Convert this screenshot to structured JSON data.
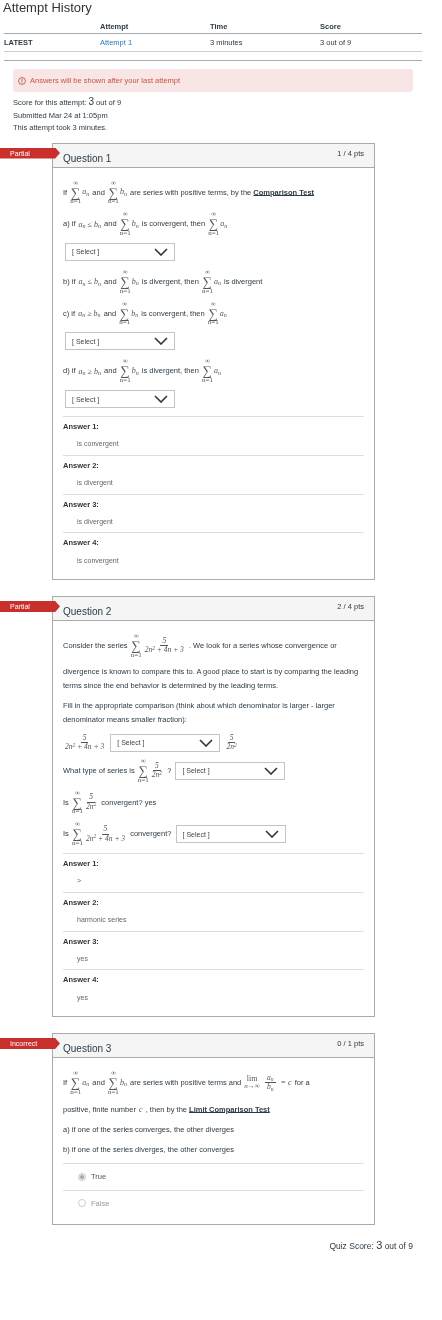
{
  "page_title": "Attempt History",
  "attempts_table": {
    "columns": [
      "Attempt",
      "Time",
      "Score"
    ],
    "rows": [
      {
        "label": "LATEST",
        "attempt": "Attempt 1",
        "time": "3 minutes",
        "score": "3 out of 9"
      }
    ]
  },
  "notice": "Answers will be shown after your last attempt",
  "score": {
    "label": "Score for this attempt:",
    "value": "3",
    "suffix": "out of 9"
  },
  "submitted": "Submitted Mar 24 at 1:05pm",
  "duration": "This attempt took 3 minutes.",
  "questions": [
    {
      "status": "Partial",
      "title": "Question 1",
      "points": "1 / 4 pts",
      "paragraphs": [
        {
          "parts": [
            {
              "kind": "text",
              "text": "If"
            },
            {
              "kind": "sum",
              "sign": "∑",
              "top": "∞",
              "bottom": "n=1",
              "term": "a$_{n}$"
            },
            {
              "kind": "text",
              "text": "and"
            },
            {
              "kind": "sum",
              "sign": "∑",
              "top": "∞",
              "bottom": "n=1",
              "term": "b$_{n}$"
            },
            {
              "kind": "text",
              "text": "are series with positive terms, by the"
            },
            {
              "kind": "link",
              "text": "Comparison Test"
            }
          ]
        },
        {
          "parts": [
            {
              "kind": "text",
              "text": "a) if"
            },
            {
              "kind": "math",
              "text": "a$_{n}$ ≤ b$_{n}$"
            },
            {
              "kind": "text",
              "text": "and"
            },
            {
              "kind": "sum",
              "sign": "∑",
              "top": "∞",
              "bottom": "n=1",
              "term": "b$_{n}$"
            },
            {
              "kind": "text",
              "text": "is convergent, then"
            },
            {
              "kind": "sum",
              "sign": "∑",
              "top": "∞",
              "bottom": "n=1",
              "term": "a$_{n}$"
            }
          ]
        },
        {
          "parts": [
            {
              "kind": "select",
              "placeholder": "[ Select ]"
            }
          ]
        },
        {
          "parts": [
            {
              "kind": "text",
              "text": "b) if"
            },
            {
              "kind": "math",
              "text": "a$_{n}$ ≤ b$_{n}$"
            },
            {
              "kind": "text",
              "text": "and"
            },
            {
              "kind": "sum",
              "sign": "∑",
              "top": "∞",
              "bottom": "n=1",
              "term": "b$_{n}$"
            },
            {
              "kind": "text",
              "text": "is divergent, then"
            },
            {
              "kind": "sum",
              "sign": "∑",
              "top": "∞",
              "bottom": "n=1",
              "term": "a$_{n}$"
            },
            {
              "kind": "text",
              "text": "is divergent"
            }
          ]
        },
        {
          "parts": [
            {
              "kind": "text",
              "text": "c) if"
            },
            {
              "kind": "math",
              "text": "a$_{n}$ ≥ b$_{n}$"
            },
            {
              "kind": "text",
              "text": "and"
            },
            {
              "kind": "sum",
              "sign": "∑",
              "top": "∞",
              "bottom": "n=1",
              "term": "b$_{n}$"
            },
            {
              "kind": "text",
              "text": "is convergent, then"
            },
            {
              "kind": "sum",
              "sign": "∑",
              "top": "∞",
              "bottom": "n=1",
              "term": "a$_{n}$"
            }
          ]
        },
        {
          "parts": [
            {
              "kind": "select",
              "placeholder": "[ Select ]"
            }
          ]
        },
        {
          "parts": [
            {
              "kind": "text",
              "text": "d) if"
            },
            {
              "kind": "math",
              "text": "a$_{n}$ ≥ b$_{n}$"
            },
            {
              "kind": "text",
              "text": "and"
            },
            {
              "kind": "sum",
              "sign": "∑",
              "top": "∞",
              "bottom": "n=1",
              "term": "b$_{n}$"
            },
            {
              "kind": "text",
              "text": "is divergent, then"
            },
            {
              "kind": "sum",
              "sign": "∑",
              "top": "∞",
              "bottom": "n=1",
              "term": "a$_{n}$"
            }
          ]
        },
        {
          "parts": [
            {
              "kind": "select",
              "placeholder": "[ Select ]"
            }
          ]
        }
      ],
      "answers": [
        {
          "label": "Answer 1:",
          "value": "is convergent"
        },
        {
          "label": "Answer 2:",
          "value": "is divergent"
        },
        {
          "label": "Answer 3:",
          "value": "is divergent"
        },
        {
          "label": "Answer 4:",
          "value": "is convergent"
        }
      ]
    },
    {
      "status": "Partial",
      "title": "Question 2",
      "points": "2 / 4 pts",
      "paragraphs": [
        {
          "parts": [
            {
              "kind": "text",
              "text": "Consider the series"
            },
            {
              "kind": "sum",
              "sign": "∑",
              "top": "∞",
              "bottom": "n=1",
              "num": "5",
              "den": "2n$^{2}$ + 4n + 3"
            },
            {
              "kind": "text",
              "text": ". We look for a series whose convergence or"
            }
          ]
        },
        {
          "parts": [
            {
              "kind": "text",
              "text": "divergence is known to compare this to. A good place to start is by comparing the leading terms since the end behavior is determined by the leading terms."
            }
          ]
        },
        {
          "parts": [
            {
              "kind": "text",
              "text": "Fill in the appropriate comparison (think about which denominator is larger - larger denominator means smaller fraction):"
            }
          ]
        },
        {
          "parts": [
            {
              "kind": "frac",
              "num": "5",
              "den": "2n$^{2}$ + 4n + 3"
            },
            {
              "kind": "select",
              "placeholder": "[ Select ]"
            },
            {
              "kind": "frac",
              "num": "5",
              "den": "2n$^{2}$"
            }
          ]
        },
        {
          "parts": [
            {
              "kind": "text",
              "text": "What type of series is"
            },
            {
              "kind": "sum",
              "sign": "∑",
              "top": "∞",
              "bottom": "n=1",
              "num": "5",
              "den": "2n$^{2}$"
            },
            {
              "kind": "text",
              "text": "?"
            },
            {
              "kind": "select",
              "placeholder": "[ Select ]"
            }
          ]
        },
        {
          "parts": [
            {
              "kind": "text",
              "text": "Is"
            },
            {
              "kind": "sum",
              "sign": "∑",
              "top": "∞",
              "bottom": "n=1",
              "num": "5",
              "den": "2n$^{2}$"
            },
            {
              "kind": "text",
              "text": "convergent? yes"
            }
          ]
        },
        {
          "parts": [
            {
              "kind": "text",
              "text": "Is"
            },
            {
              "kind": "sum",
              "sign": "∑",
              "top": "∞",
              "bottom": "n=1",
              "num": "5",
              "den": "2n$^{2}$ + 4n + 3"
            },
            {
              "kind": "text",
              "text": "convergent?"
            },
            {
              "kind": "select",
              "placeholder": "[ Select ]"
            }
          ]
        }
      ],
      "answers": [
        {
          "label": "Answer 1:",
          "value": ">"
        },
        {
          "label": "Answer 2:",
          "value": "harmonic series"
        },
        {
          "label": "Answer 3:",
          "value": "yes"
        },
        {
          "label": "Answer 4:",
          "value": "yes"
        }
      ]
    },
    {
      "status": "Incorrect",
      "title": "Question 3",
      "points": "0 / 1 pts",
      "paragraphs": [
        {
          "parts": [
            {
              "kind": "text",
              "text": "If"
            },
            {
              "kind": "sum",
              "sign": "∑",
              "top": "∞",
              "bottom": "n=1",
              "term": "a$_{n}$"
            },
            {
              "kind": "text",
              "text": "and"
            },
            {
              "kind": "sum",
              "sign": "∑",
              "top": "∞",
              "bottom": "n=1",
              "term": "b$_{n}$"
            },
            {
              "kind": "text",
              "text": "are series with positive terms and"
            },
            {
              "kind": "limit",
              "text": "lim",
              "under": "n→∞"
            },
            {
              "kind": "frac",
              "num": "a$_{n}$",
              "den": "b$_{n}$"
            },
            {
              "kind": "math",
              "text": "= c"
            },
            {
              "kind": "text",
              "text": "for a"
            }
          ]
        },
        {
          "parts": [
            {
              "kind": "text",
              "text": "positive, finite number"
            },
            {
              "kind": "math",
              "text": "c"
            },
            {
              "kind": "text",
              "text": ", then by the"
            },
            {
              "kind": "link",
              "text": "Limit Comparison Test"
            }
          ]
        },
        {
          "parts": [
            {
              "kind": "text",
              "text": "a) if one of the series converges, the other diverges"
            }
          ]
        },
        {
          "parts": [
            {
              "kind": "text",
              "text": "b) if one of the series diverges, the other converges"
            }
          ]
        }
      ],
      "options": [
        {
          "label": "True",
          "selected": true
        },
        {
          "label": "False",
          "selected": false
        }
      ]
    }
  ],
  "quiz_score": {
    "label": "Quiz Score:",
    "value": "3",
    "suffix": "out of 9"
  }
}
